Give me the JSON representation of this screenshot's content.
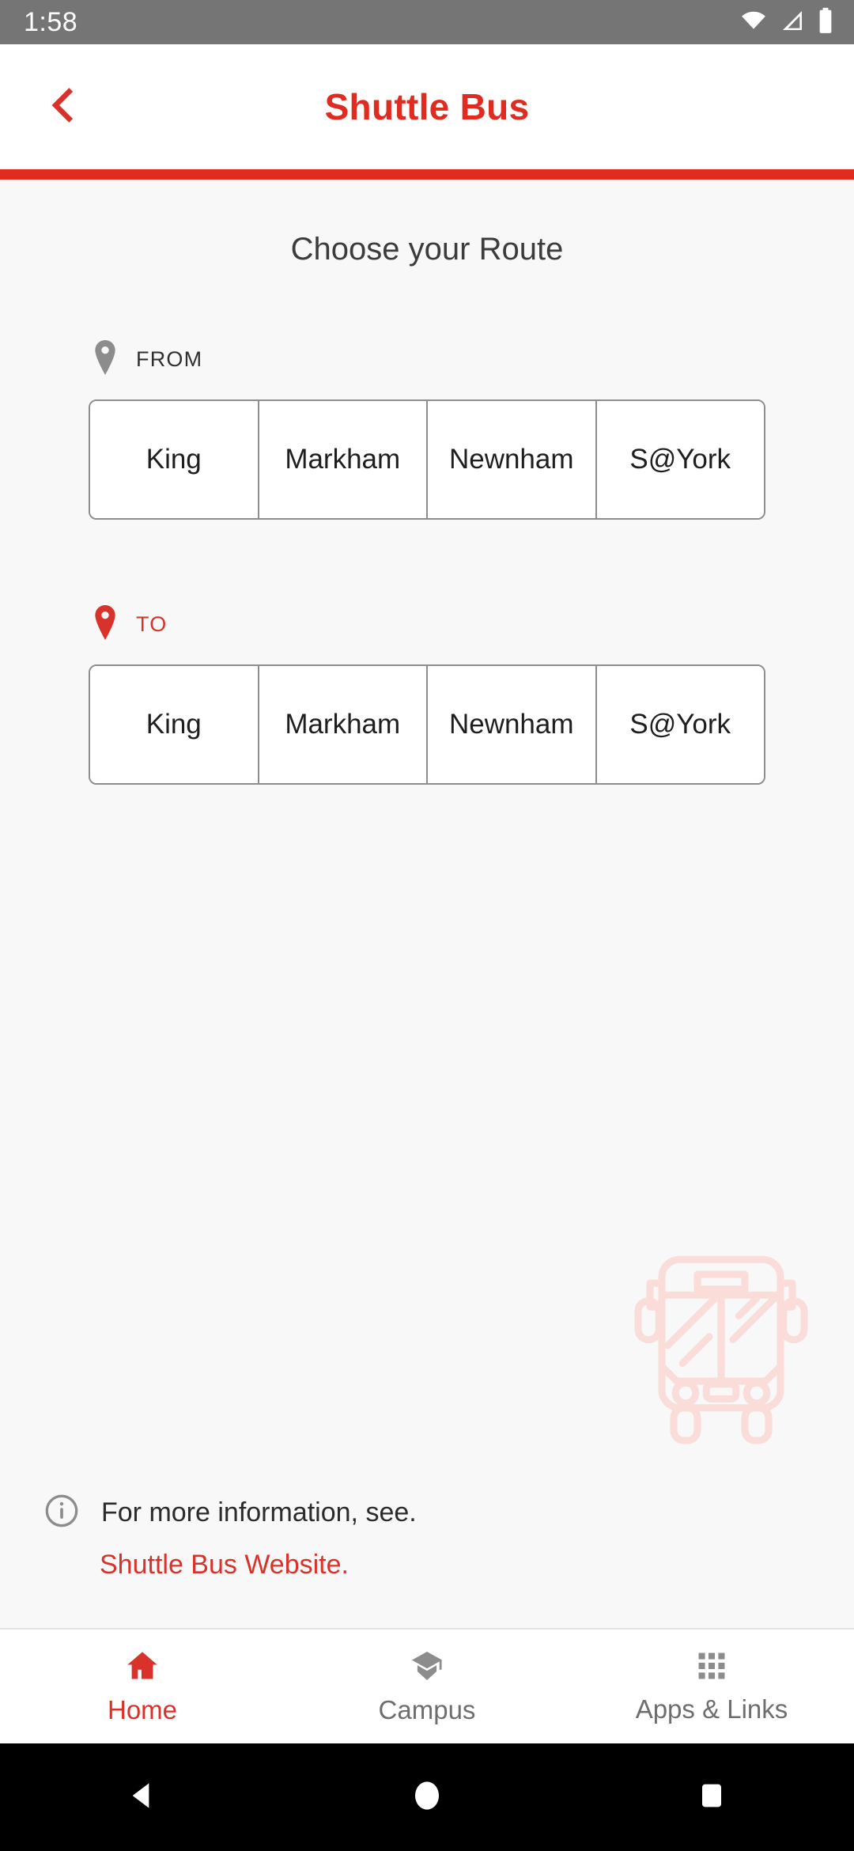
{
  "statusbar": {
    "time": "1:58",
    "icons": [
      "wifi-icon",
      "cell-signal-icon",
      "battery-icon"
    ]
  },
  "appbar": {
    "back_icon": "chevron-left-icon",
    "title": "Shuttle Bus",
    "accent_color": "#e02b20"
  },
  "main": {
    "screen_title": "Choose your Route",
    "from": {
      "pin_icon": "location-pin-icon",
      "label": "FROM",
      "label_color": "#2f2f2f",
      "options": [
        "King",
        "Markham",
        "Newnham",
        "S@York"
      ]
    },
    "to": {
      "pin_icon": "location-pin-icon",
      "label": "TO",
      "label_color": "#d8322a",
      "options": [
        "King",
        "Markham",
        "Newnham",
        "S@York"
      ]
    },
    "watermark_icon": "bus-front-icon",
    "info": {
      "icon": "info-circle-icon",
      "text": "For more information, see.",
      "link_text": "Shuttle Bus Website.",
      "link_color": "#d8322a"
    }
  },
  "tabbar": {
    "tabs": [
      {
        "label": "Home",
        "icon": "home-icon",
        "active": true
      },
      {
        "label": "Campus",
        "icon": "graduation-cap-icon",
        "active": false
      },
      {
        "label": "Apps & Links",
        "icon": "grid-apps-icon",
        "active": false
      }
    ]
  },
  "navbar": {
    "back": "triangle-back-icon",
    "home": "circle-home-icon",
    "recents": "square-recents-icon"
  }
}
